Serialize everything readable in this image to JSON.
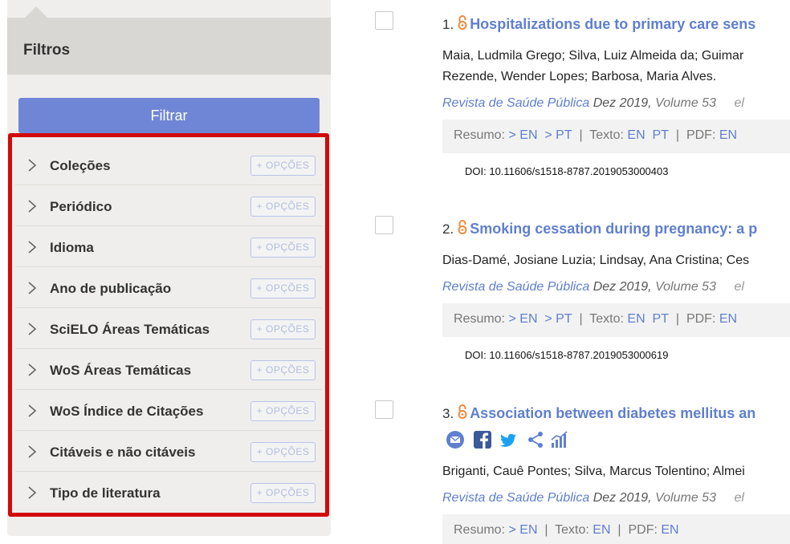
{
  "sidebar": {
    "title": "Filtros",
    "filter_button": "Filtrar",
    "option_label": "+ OPÇÕES",
    "facets": [
      {
        "label": "Coleções"
      },
      {
        "label": "Periódico"
      },
      {
        "label": "Idioma"
      },
      {
        "label": "Ano de publicação"
      },
      {
        "label": "SciELO Áreas Temáticas"
      },
      {
        "label": "WoS Áreas Temáticas"
      },
      {
        "label": "WoS Índice de Citações"
      },
      {
        "label": "Citáveis e não citáveis"
      },
      {
        "label": "Tipo de literatura"
      }
    ]
  },
  "results": [
    {
      "number": "1.",
      "title": "Hospitalizations due to primary care sens",
      "authors_line1": "Maia, Ludmila Grego; Silva, Luiz Almeida da; Guimar",
      "authors_line2": "Rezende, Wender Lopes; Barbosa, Maria Alves.",
      "journal": "Revista de Saúde Pública",
      "date": "Dez 2019,",
      "volume": "Volume 53",
      "extra": "el",
      "links": {
        "resumo": "Resumo:",
        "res_en": "> EN",
        "res_pt": "> PT",
        "texto": "Texto:",
        "txt_en": "EN",
        "txt_pt": "PT",
        "pdf": "PDF:",
        "pdf_en": "EN",
        "sep": "|"
      },
      "doi": "DOI: 10.11606/s1518-8787.2019053000403"
    },
    {
      "number": "2.",
      "title": "Smoking cessation during pregnancy: a p",
      "authors_line1": "Dias-Damé, Josiane Luzia; Lindsay, Ana Cristina; Ces",
      "journal": "Revista de Saúde Pública",
      "date": "Dez 2019,",
      "volume": "Volume 53",
      "extra": "el",
      "links": {
        "resumo": "Resumo:",
        "res_en": "> EN",
        "res_pt": "> PT",
        "texto": "Texto:",
        "txt_en": "EN",
        "txt_pt": "PT",
        "pdf": "PDF:",
        "pdf_en": "EN",
        "sep": "|"
      },
      "doi": "DOI: 10.11606/s1518-8787.2019053000619"
    },
    {
      "number": "3.",
      "title": "Association between diabetes mellitus an",
      "authors_line1": "Briganti, Cauê Pontes; Silva, Marcus Tolentino; Almei",
      "journal": "Revista de Saúde Pública",
      "date": "Dez 2019,",
      "volume": "Volume 53",
      "extra": "el",
      "links": {
        "resumo": "Resumo:",
        "res_en": "> EN",
        "texto": "Texto:",
        "txt_en": "EN",
        "pdf": "PDF:",
        "pdf_en": "EN",
        "sep": "|"
      }
    }
  ],
  "social_icons": [
    "email-icon",
    "facebook-icon",
    "twitter-icon",
    "share-icon",
    "metrics-icon"
  ],
  "colors": {
    "accent": "#5f7fcf",
    "filter_button": "#6f86d6",
    "highlight": "#d10a0a",
    "open_access": "#f08a3c"
  }
}
